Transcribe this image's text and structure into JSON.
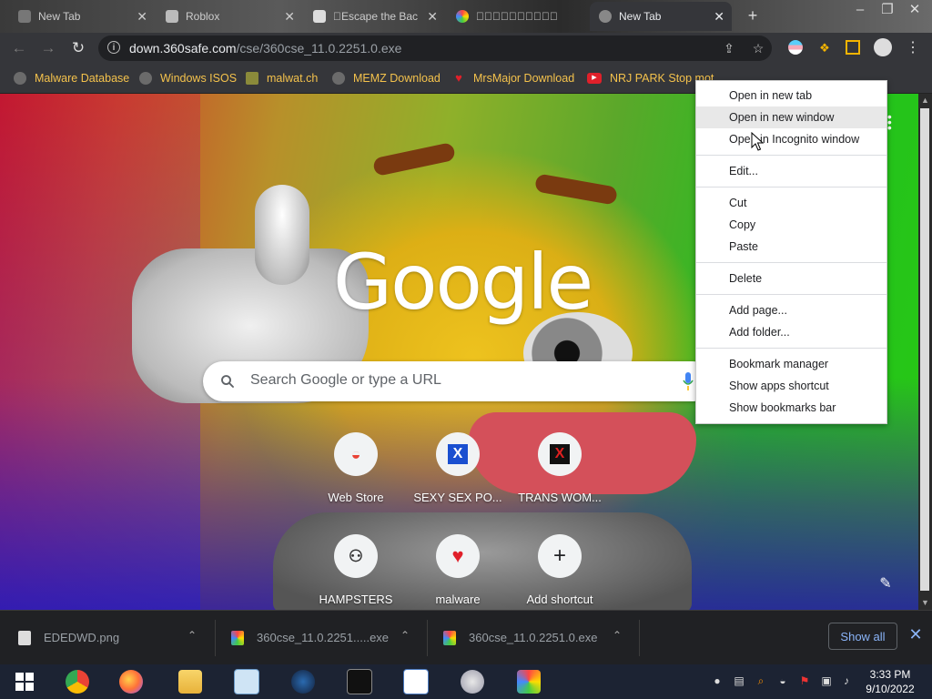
{
  "tabs": [
    {
      "label": "New Tab",
      "active": false
    },
    {
      "label": "Roblox",
      "active": false
    },
    {
      "label": "\u0000Escape the Bac",
      "active": false
    },
    {
      "label": "\u0000\u0000\u0000\u0000\u0000\u0000\u0000\u0000\u0000\u0000",
      "active": false
    },
    {
      "label": "New Tab",
      "active": true
    }
  ],
  "tab_close": "✕",
  "newtab_symbol": "+",
  "window_controls": {
    "minimize": "–",
    "restore": "❐",
    "close": "✕"
  },
  "toolbar": {
    "back": "←",
    "forward": "→",
    "reload": "↻",
    "info": "i",
    "url_host": "down.360safe.com",
    "url_path": "/cse/360cse_11.0.2251.0.exe",
    "share": "⇪",
    "star": "☆",
    "menu": "⋮"
  },
  "bookmarks": [
    {
      "label": "Malware Database",
      "icon": "globe-icon"
    },
    {
      "label": "Windows ISOS",
      "icon": "globe-icon"
    },
    {
      "label": "malwat.ch",
      "icon": "bug-icon"
    },
    {
      "label": "MEMZ Download",
      "icon": "globe-icon"
    },
    {
      "label": "MrsMajor Download",
      "icon": "heart-icon"
    },
    {
      "label": "NRJ PARK Stop mot...",
      "icon": "youtube-icon"
    }
  ],
  "ntp": {
    "logo": "Google",
    "search_placeholder": "Search Google or type a URL",
    "shortcuts": [
      {
        "label": "Web Store",
        "glyph": "◒"
      },
      {
        "label": "SEXY SEX PO...",
        "glyph": "X"
      },
      {
        "label": "TRANS WOM...",
        "glyph": "X"
      },
      {
        "label": "HAMPSTERS",
        "glyph": "⚇"
      },
      {
        "label": "malware",
        "glyph": "♥"
      },
      {
        "label": "Add shortcut",
        "glyph": "+"
      }
    ],
    "customize": "✎"
  },
  "context_menu": [
    {
      "label": "Open in new tab"
    },
    {
      "label": "Open in new window"
    },
    {
      "label": "Open in Incognito window"
    },
    {
      "label": "Edit..."
    },
    {
      "label": "Cut"
    },
    {
      "label": "Copy"
    },
    {
      "label": "Paste"
    },
    {
      "label": "Delete"
    },
    {
      "label": "Add page..."
    },
    {
      "label": "Add folder..."
    },
    {
      "label": "Bookmark manager"
    },
    {
      "label": "Show apps shortcut"
    },
    {
      "label": "Show bookmarks bar"
    }
  ],
  "downloads": [
    {
      "name": "EDEDWD.png"
    },
    {
      "name": "360cse_11.0.2251.....exe"
    },
    {
      "name": "360cse_11.0.2251.0.exe"
    }
  ],
  "download_bar": {
    "show_all": "Show all",
    "close": "✕",
    "chevron": "⌃"
  },
  "taskbar": {
    "apps": [
      "windows-start",
      "chrome",
      "firefox",
      "file-explorer",
      "task-manager",
      "steam",
      "command-prompt",
      "wordpad",
      "paint",
      "chrome-canary"
    ],
    "time": "3:33 PM",
    "date": "9/10/2022"
  },
  "colors": {
    "bookmark_text": "#f4c24c",
    "accent": "#8ab4f8"
  }
}
